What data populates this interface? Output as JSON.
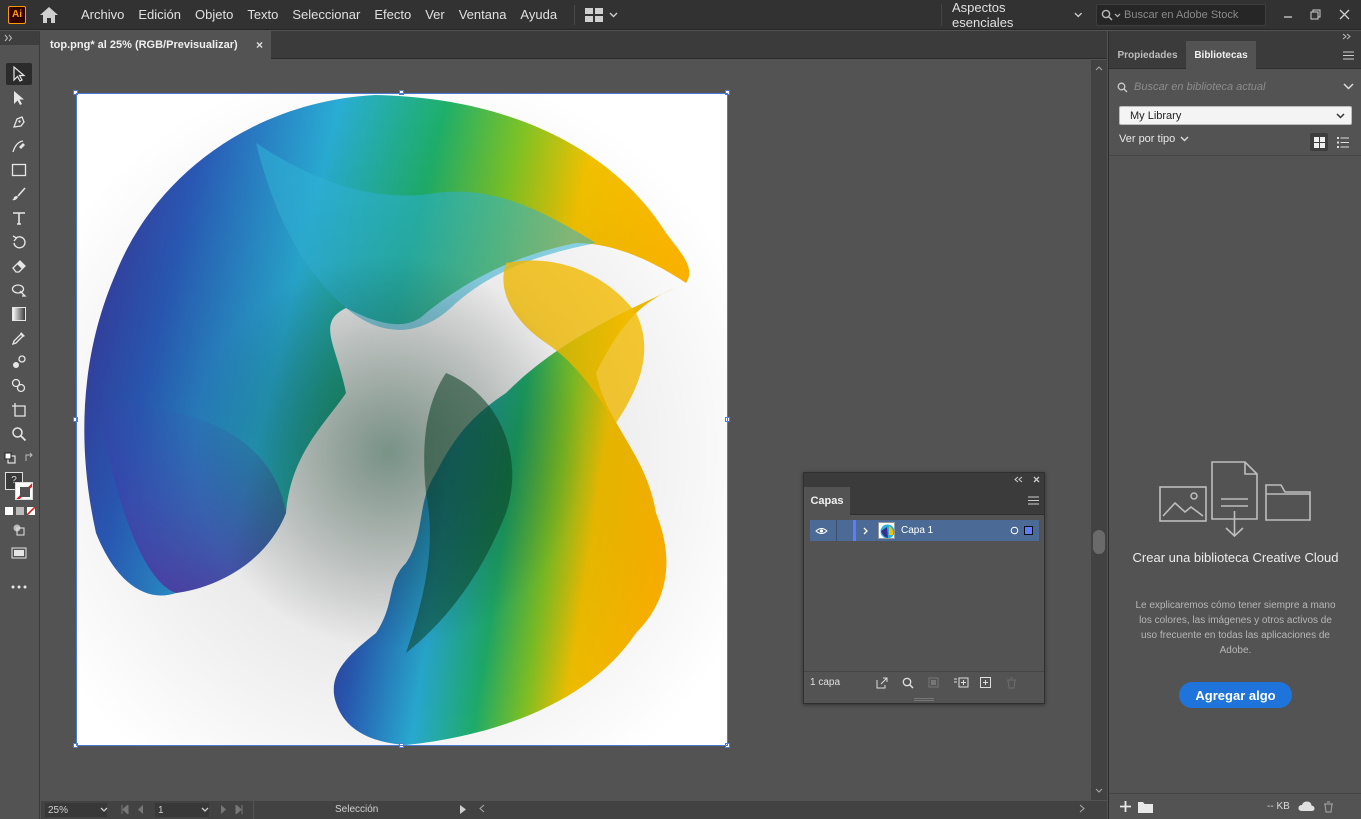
{
  "app": {
    "logo_text": "Ai",
    "menu": [
      "Archivo",
      "Edición",
      "Objeto",
      "Texto",
      "Seleccionar",
      "Efecto",
      "Ver",
      "Ventana",
      "Ayuda"
    ],
    "workspace": "Aspectos esenciales",
    "stock_search_placeholder": "Buscar en Adobe Stock"
  },
  "document": {
    "tab_title": "top.png* al 25% (RGB/Previsualizar)",
    "close_glyph": "×"
  },
  "status": {
    "zoom": "25%",
    "artboard_number": "1",
    "tool_status": "Selección"
  },
  "layers_panel": {
    "tab": "Capas",
    "layer_name": "Capa 1",
    "layer_count": "1 capa"
  },
  "right_panel": {
    "tabs": [
      "Propiedades",
      "Bibliotecas"
    ],
    "active_tab": "Bibliotecas",
    "search_placeholder": "Buscar en biblioteca actual",
    "library": "My Library",
    "view_by": "Ver por tipo",
    "empty_title": "Crear una biblioteca Creative Cloud",
    "empty_desc": "Le explicaremos cómo tener siempre a mano los colores, las imágenes y otros activos de uso frecuente en todas las aplicaciones de Adobe.",
    "cta": "Agregar algo",
    "storage": "-- KB"
  },
  "colors": {
    "accent": "#1e74db",
    "selection": "#4c7bd8",
    "layer_highlight": "#4c6a96"
  }
}
